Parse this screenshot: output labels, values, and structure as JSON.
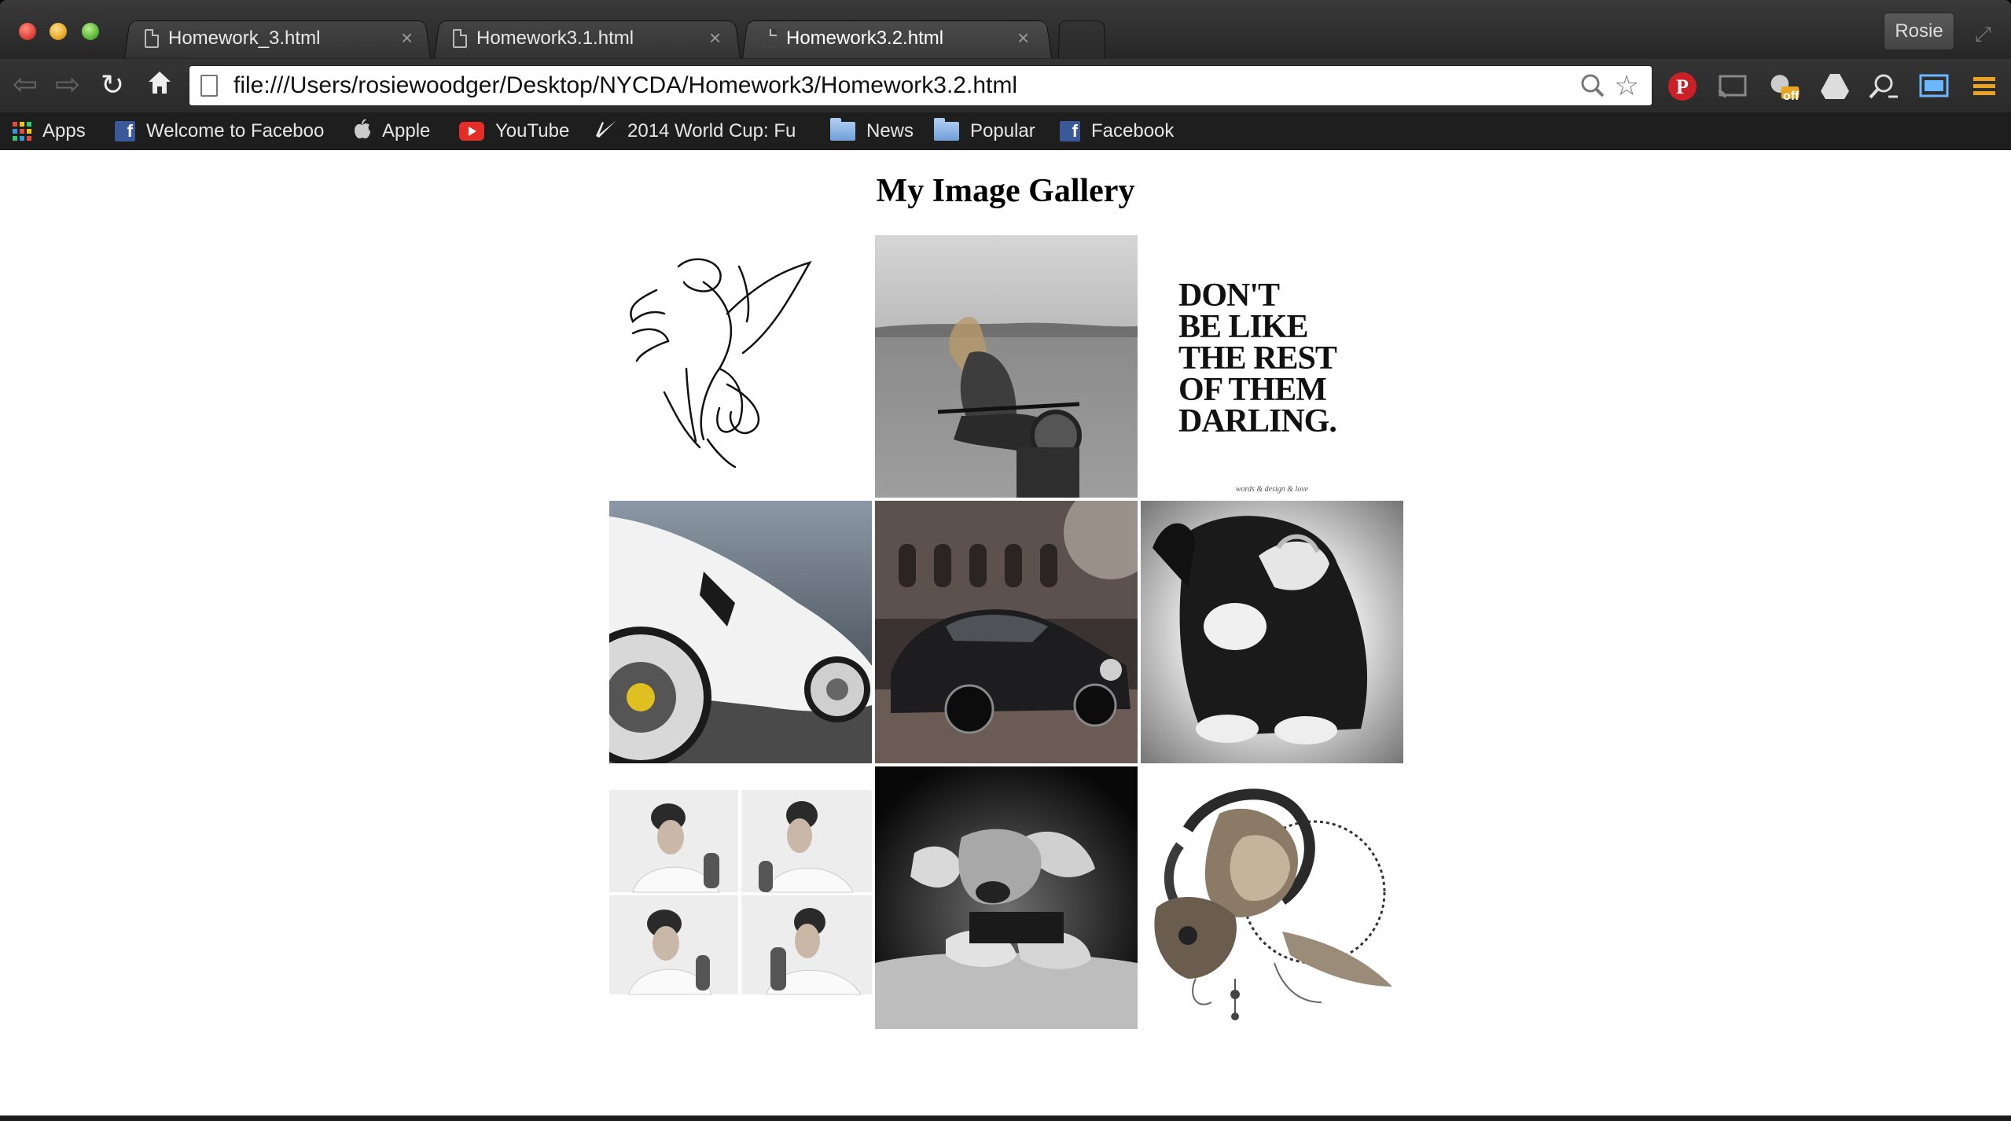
{
  "browser": {
    "tabs": [
      {
        "label": "Homework_3.html",
        "active": false
      },
      {
        "label": "Homework3.1.html",
        "active": false
      },
      {
        "label": "Homework3.2.html",
        "active": true
      }
    ],
    "profile_label": "Rosie",
    "url": "file:///Users/rosiewoodger/Desktop/NYCDA/Homework3/Homework3.2.html",
    "bookmarks": [
      {
        "label": "Apps",
        "icon": "apps-grid-icon"
      },
      {
        "label": "Welcome to Faceboo",
        "icon": "facebook-icon"
      },
      {
        "label": "Apple",
        "icon": "apple-icon"
      },
      {
        "label": "YouTube",
        "icon": "youtube-icon"
      },
      {
        "label": "2014 World Cup: Fu",
        "icon": "nike-icon"
      },
      {
        "label": "News",
        "icon": "folder-icon"
      },
      {
        "label": "Popular",
        "icon": "folder-icon"
      },
      {
        "label": "Facebook",
        "icon": "facebook-icon"
      }
    ],
    "extensions": [
      "pinterest-icon",
      "cast-icon",
      "adblock-off-icon",
      "google-drive-icon",
      "search-extension-icon",
      "screen-capture-icon",
      "menu-icon"
    ],
    "extension_badge": "off"
  },
  "page": {
    "title": "My Image Gallery",
    "images": [
      {
        "name": "tinkerbell-line-drawing",
        "text": ""
      },
      {
        "name": "woman-on-motorcycle-photo",
        "text": ""
      },
      {
        "name": "dont-be-like-the-rest-quote",
        "text": "DON'T BE LIKE THE REST OF THEM DARLING.",
        "lines": [
          "DON'T",
          "BE LIKE",
          "THE REST",
          "OF THEM",
          "DARLING."
        ],
        "footer": "words & design & love"
      },
      {
        "name": "white-sports-car-photo",
        "text": ""
      },
      {
        "name": "vintage-porsche-photo",
        "text": ""
      },
      {
        "name": "puppy-covering-face-photo",
        "text": ""
      },
      {
        "name": "man-portrait-collage",
        "text": ""
      },
      {
        "name": "puppy-resting-photo",
        "text": ""
      },
      {
        "name": "ram-lion-dreamcatcher-illustration",
        "text": ""
      }
    ]
  }
}
